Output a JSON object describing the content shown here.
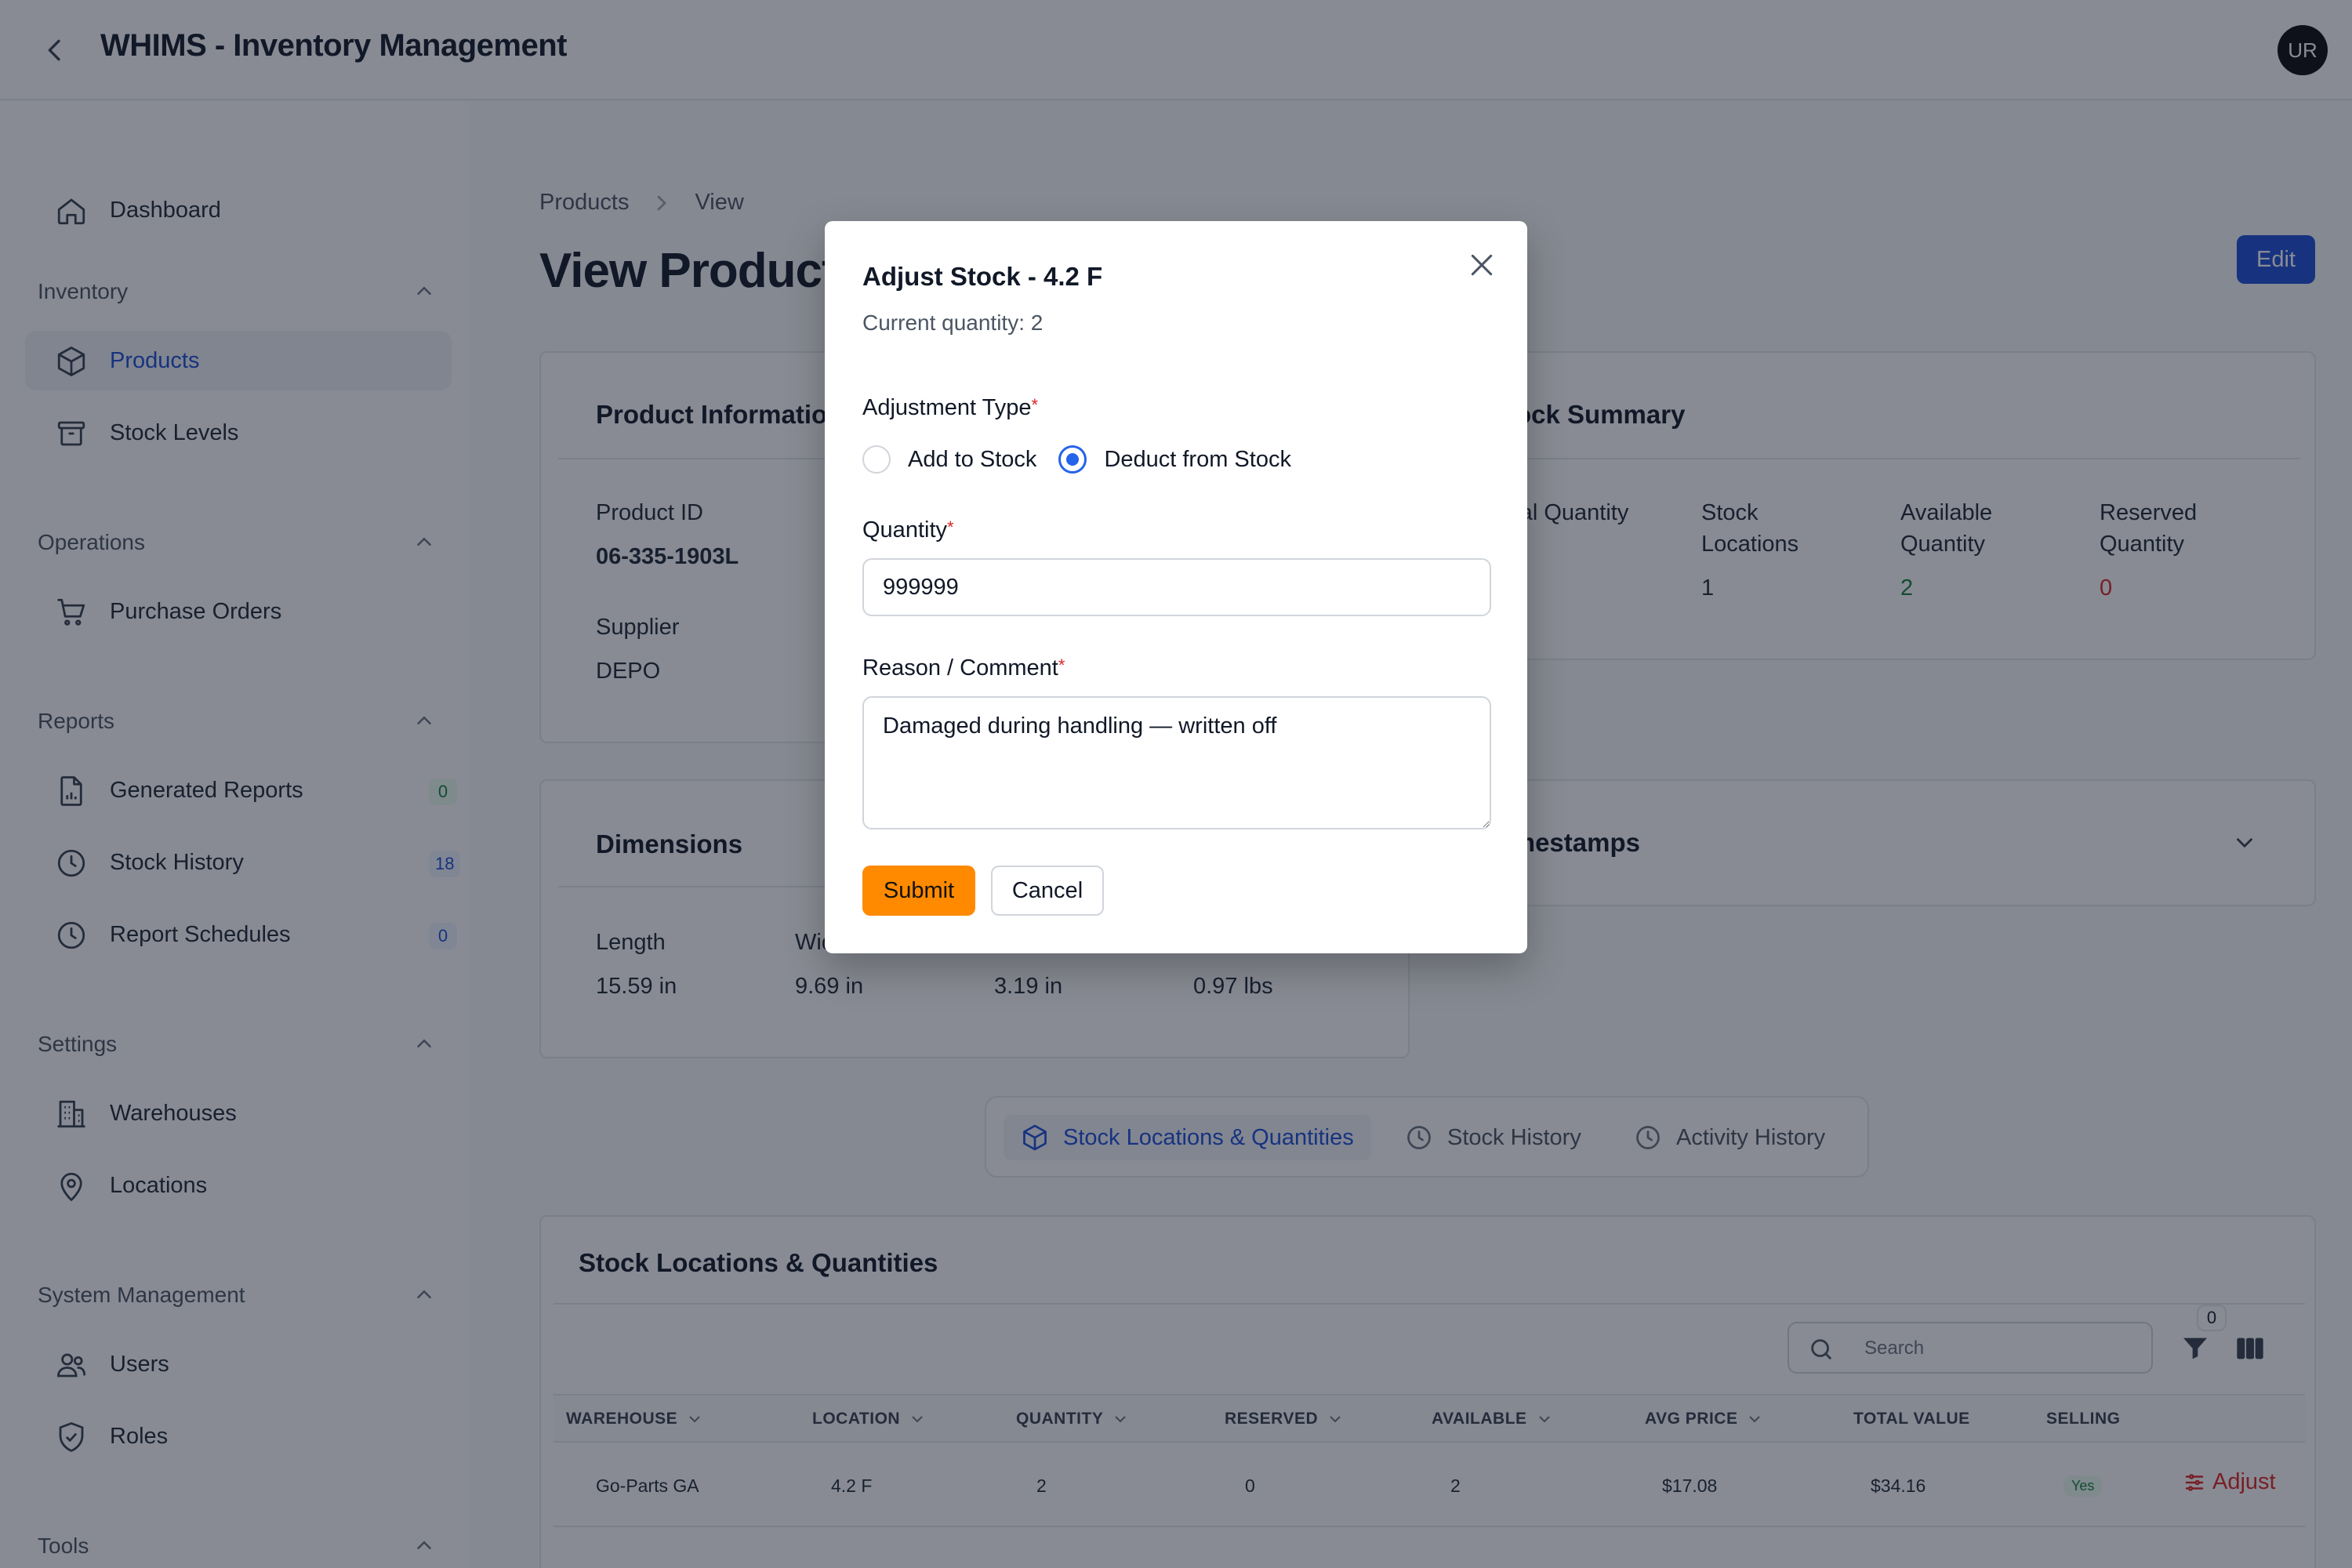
{
  "header": {
    "title": "WHIMS - Inventory Management",
    "avatar_initials": "UR"
  },
  "sidebar": {
    "dashboard": "Dashboard",
    "sections": {
      "inventory": "Inventory",
      "operations": "Operations",
      "reports": "Reports",
      "settings": "Settings",
      "system": "System Management",
      "tools": "Tools"
    },
    "items": {
      "products": "Products",
      "stock_levels": "Stock Levels",
      "purchase_orders": "Purchase Orders",
      "generated_reports": "Generated Reports",
      "stock_history": "Stock History",
      "report_schedules": "Report Schedules",
      "warehouses": "Warehouses",
      "locations": "Locations",
      "users": "Users",
      "roles": "Roles"
    },
    "badges": {
      "generated_reports": "0",
      "stock_history": "18",
      "report_schedules": "0"
    },
    "active_item": "Products"
  },
  "breadcrumb": {
    "parent": "Products",
    "current": "View"
  },
  "page": {
    "title": "View Product",
    "edit_label": "Edit"
  },
  "product_info": {
    "title": "Product Information",
    "product_id_label": "Product ID",
    "product_id": "06-335-1903L",
    "supplier_label": "Supplier",
    "supplier": "DEPO"
  },
  "stock_summary": {
    "title": "Stock Summary",
    "total_label": "Total Quantity",
    "locations_label": "Stock Locations",
    "locations_value": "1",
    "available_label": "Available Quantity",
    "available_value": "2",
    "reserved_label": "Reserved Quantity",
    "reserved_value": "0"
  },
  "dimensions": {
    "title": "Dimensions",
    "length_label": "Length",
    "length": "15.59 in",
    "width_label": "Width",
    "width": "9.69 in",
    "height": "3.19 in",
    "weight": "0.97 lbs"
  },
  "timestamps": {
    "title": "Timestamps"
  },
  "tabs": {
    "stock_locations": "Stock Locations & Quantities",
    "stock_history": "Stock History",
    "activity_history": "Activity History",
    "active": "Stock Locations & Quantities"
  },
  "table": {
    "title": "Stock Locations & Quantities",
    "search_placeholder": "Search",
    "filter_count": "0",
    "columns": [
      "WAREHOUSE",
      "LOCATION",
      "QUANTITY",
      "RESERVED",
      "AVAILABLE",
      "AVG PRICE",
      "TOTAL VALUE",
      "SELLING"
    ],
    "rows": [
      {
        "warehouse": "Go-Parts GA",
        "location": "4.2 F",
        "quantity": "2",
        "reserved": "0",
        "available": "2",
        "avg_price": "$17.08",
        "total_value": "$34.16",
        "selling": "Yes",
        "action": "Adjust"
      }
    ]
  },
  "modal": {
    "title": "Adjust Stock - 4.2 F",
    "subtitle": "Current quantity: 2",
    "adjustment_type_label": "Adjustment Type",
    "option_add": "Add to Stock",
    "option_deduct": "Deduct from Stock",
    "selected_option": "Deduct from Stock",
    "quantity_label": "Quantity",
    "quantity_value": "999999",
    "reason_label": "Reason / Comment",
    "reason_value": "Damaged during handling — written off",
    "required_mark": "*",
    "submit_label": "Submit",
    "cancel_label": "Cancel"
  },
  "colors": {
    "primary": "#1d4ed8",
    "accent_orange": "#ff8a00",
    "success": "#15803d",
    "danger": "#dc2626",
    "overlay": "rgba(17,24,39,0.5)"
  }
}
